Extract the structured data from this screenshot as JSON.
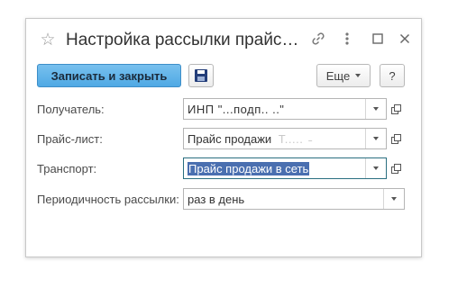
{
  "window": {
    "title": "Настройка рассылки прайс…",
    "link_icon": "link-icon",
    "more_icon": "vertical-dots-icon",
    "maximize_icon": "maximize-icon",
    "close_icon": "close-icon"
  },
  "toolbar": {
    "save_close_label": "Записать и закрыть",
    "save_icon": "floppy-disk-icon",
    "more_label": "Еще",
    "help_label": "?"
  },
  "form": {
    "recipient": {
      "label": "Получатель:",
      "value": "ИНП \"...подп.. ..\""
    },
    "pricelist": {
      "label": "Прайс-лист:",
      "value": "Прайс продажи",
      "value_tail": "Т.....",
      "value_tail2": "˗"
    },
    "transport": {
      "label": "Транспорт:",
      "value": "Прайс продажи в сеть"
    },
    "periodicity": {
      "label": "Периодичность рассылки:",
      "value": "раз в день"
    }
  },
  "colors": {
    "primary_button": "#4fa9e4",
    "focus_border": "#2a6f80",
    "selection": "#4a6fb0"
  }
}
